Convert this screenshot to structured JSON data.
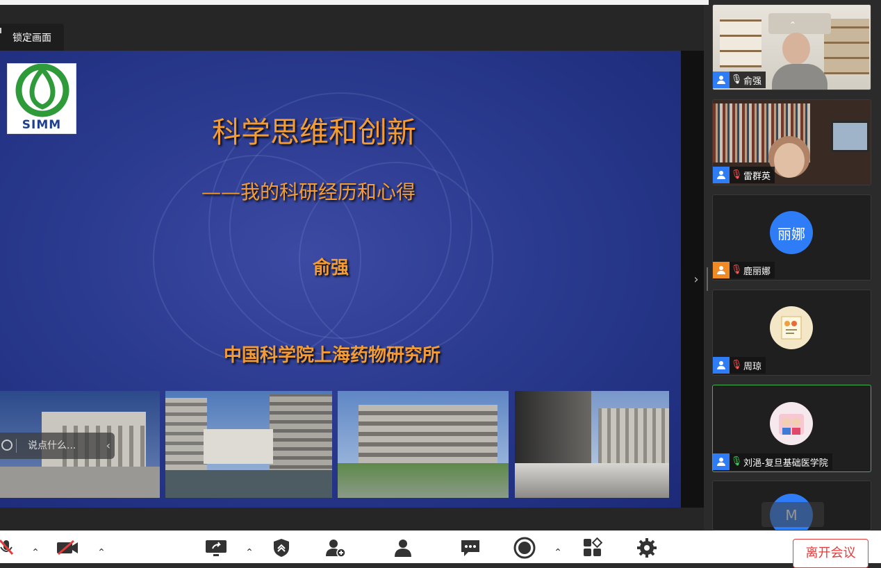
{
  "overlay": {
    "lock_label": "锁定画面",
    "chat_placeholder": "说点什么..."
  },
  "slide": {
    "logo_text": "SIMM",
    "title": "科学思维和创新",
    "subtitle": "——我的科研经历和心得",
    "author": "俞强",
    "institute": "中国科学院上海药物研究所"
  },
  "participants": [
    {
      "name": "俞强",
      "role_color": "#2f7df6",
      "mic": "normal",
      "avatar": "",
      "type": "video"
    },
    {
      "name": "雷群英",
      "role_color": "#2f7df6",
      "mic": "muted",
      "avatar": "",
      "type": "video"
    },
    {
      "name": "鹿丽娜",
      "role_color": "#f08a24",
      "mic": "muted",
      "avatar": "丽娜",
      "type": "avatar"
    },
    {
      "name": "周琼",
      "role_color": "#2f7df6",
      "mic": "muted",
      "avatar": "",
      "type": "image"
    },
    {
      "name": "刘浥-复旦基础医学院",
      "role_color": "#2f7df6",
      "mic": "on",
      "avatar": "",
      "type": "image"
    },
    {
      "name": "",
      "role_color": "#2f7df6",
      "mic": "",
      "avatar": "M",
      "type": "avatar"
    }
  ],
  "toolbar": {
    "leave_label": "离开会议",
    "icons": [
      "mic-muted-icon",
      "camera-off-icon",
      "share-screen-icon",
      "security-icon",
      "invite-icon",
      "participants-icon",
      "chat-icon",
      "record-icon",
      "apps-icon",
      "settings-icon"
    ]
  },
  "colors": {
    "accent_orange": "#f39c35",
    "leave_red": "#e23c3c",
    "active_green": "#3fb34f"
  }
}
